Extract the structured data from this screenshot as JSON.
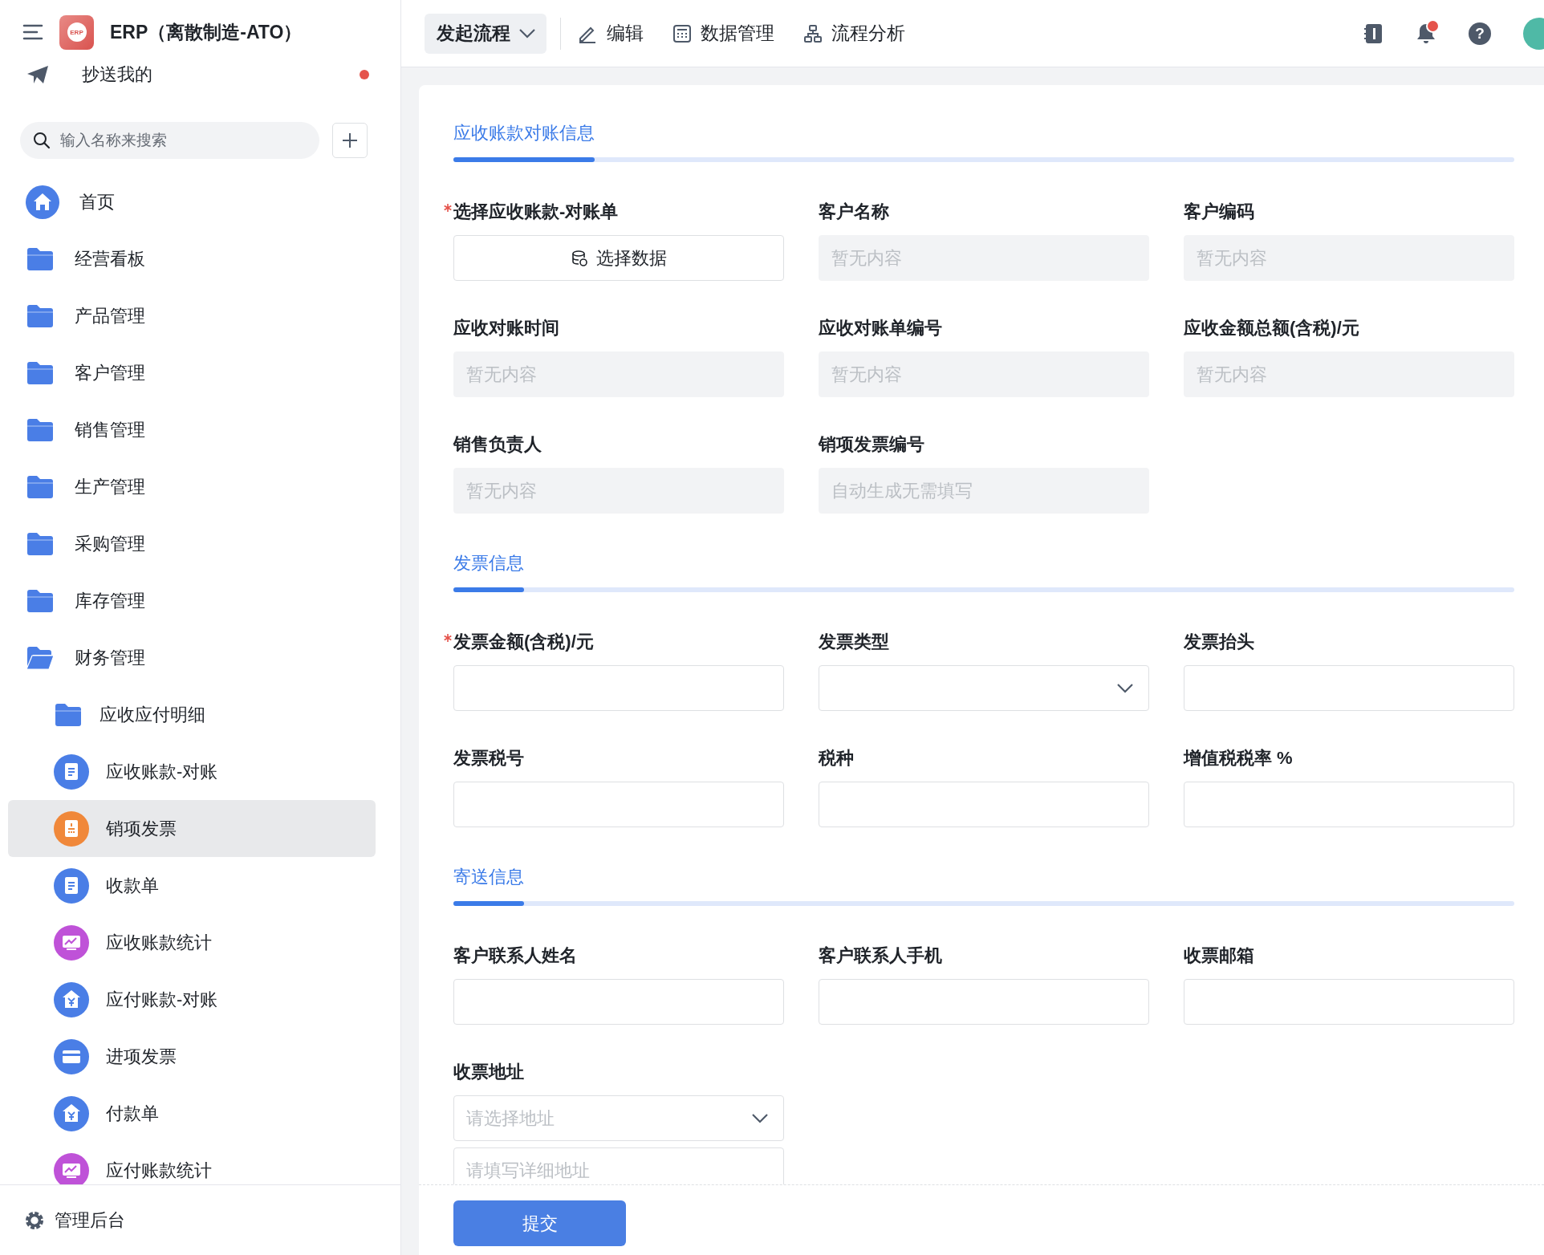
{
  "app": {
    "title": "ERP（离散制造-ATO）",
    "logo_text": "ERP"
  },
  "sidebar": {
    "cc_item": {
      "label": "抄送我的",
      "unread": true
    },
    "search": {
      "placeholder": "输入名称来搜索"
    },
    "items": [
      {
        "label": "首页",
        "kind": "home",
        "selected": false
      },
      {
        "label": "经营看板",
        "kind": "folder",
        "expanded": false,
        "selected": false
      },
      {
        "label": "产品管理",
        "kind": "folder",
        "expanded": false,
        "selected": false
      },
      {
        "label": "客户管理",
        "kind": "folder",
        "expanded": false,
        "selected": false
      },
      {
        "label": "销售管理",
        "kind": "folder",
        "expanded": false,
        "selected": false
      },
      {
        "label": "生产管理",
        "kind": "folder",
        "expanded": false,
        "selected": false
      },
      {
        "label": "采购管理",
        "kind": "folder",
        "expanded": false,
        "selected": false
      },
      {
        "label": "库存管理",
        "kind": "folder",
        "expanded": false,
        "selected": false
      },
      {
        "label": "财务管理",
        "kind": "folder",
        "expanded": true,
        "selected": false,
        "children": [
          {
            "label": "应收应付明细",
            "kind": "folder",
            "expanded": false,
            "selected": false
          },
          {
            "label": "应收账款-对账",
            "kind": "doc",
            "color": "#4a7ee6",
            "selected": false
          },
          {
            "label": "销项发票",
            "kind": "invoice",
            "color": "#f0883a",
            "selected": true
          },
          {
            "label": "收款单",
            "kind": "doc",
            "color": "#4a7ee6",
            "selected": false
          },
          {
            "label": "应收账款统计",
            "kind": "stats",
            "color": "#bf52d8",
            "selected": false
          },
          {
            "label": "应付账款-对账",
            "kind": "yen",
            "color": "#4a7ee6",
            "selected": false
          },
          {
            "label": "进项发票",
            "kind": "card",
            "color": "#4a7ee6",
            "selected": false
          },
          {
            "label": "付款单",
            "kind": "yen",
            "color": "#4a7ee6",
            "selected": false
          },
          {
            "label": "应付账款统计",
            "kind": "stats",
            "color": "#bf52d8",
            "selected": false
          }
        ]
      }
    ],
    "footer": {
      "label": "管理后台"
    }
  },
  "toolbar": {
    "start_menu": "发起流程",
    "actions": [
      {
        "label": "编辑",
        "kind": "edit"
      },
      {
        "label": "数据管理",
        "kind": "data"
      },
      {
        "label": "流程分析",
        "kind": "flow"
      }
    ],
    "notifications": {
      "unread": true
    },
    "help": "?"
  },
  "form": {
    "sections": [
      {
        "title": "应收账款对账信息",
        "fields": [
          {
            "label": "选择应收账款-对账单",
            "required": true,
            "kind": "picker",
            "text": "选择数据"
          },
          {
            "label": "客户名称",
            "required": false,
            "kind": "readonly",
            "placeholder": "暂无内容"
          },
          {
            "label": "客户编码",
            "required": false,
            "kind": "readonly",
            "placeholder": "暂无内容"
          },
          {
            "label": "应收对账时间",
            "required": false,
            "kind": "readonly",
            "placeholder": "暂无内容"
          },
          {
            "label": "应收对账单编号",
            "required": false,
            "kind": "readonly",
            "placeholder": "暂无内容"
          },
          {
            "label": "应收金额总额(含税)/元",
            "required": false,
            "kind": "readonly",
            "placeholder": "暂无内容"
          },
          {
            "label": "销售负责人",
            "required": false,
            "kind": "readonly",
            "placeholder": "暂无内容"
          },
          {
            "label": "销项发票编号",
            "required": false,
            "kind": "readonly",
            "placeholder": "自动生成无需填写"
          }
        ]
      },
      {
        "title": "发票信息",
        "fields": [
          {
            "label": "发票金额(含税)/元",
            "required": true,
            "kind": "input"
          },
          {
            "label": "发票类型",
            "required": false,
            "kind": "select"
          },
          {
            "label": "发票抬头",
            "required": false,
            "kind": "input"
          },
          {
            "label": "发票税号",
            "required": false,
            "kind": "input"
          },
          {
            "label": "税种",
            "required": false,
            "kind": "input"
          },
          {
            "label": "增值税税率 %",
            "required": false,
            "kind": "input"
          }
        ]
      },
      {
        "title": "寄送信息",
        "fields": [
          {
            "label": "客户联系人姓名",
            "required": false,
            "kind": "input"
          },
          {
            "label": "客户联系人手机",
            "required": false,
            "kind": "input"
          },
          {
            "label": "收票邮箱",
            "required": false,
            "kind": "input"
          },
          {
            "label": "收票地址",
            "required": false,
            "kind": "address",
            "placeholder": "请选择地址",
            "detail_placeholder": "请填写详细地址"
          }
        ]
      }
    ],
    "submit": "提交"
  }
}
